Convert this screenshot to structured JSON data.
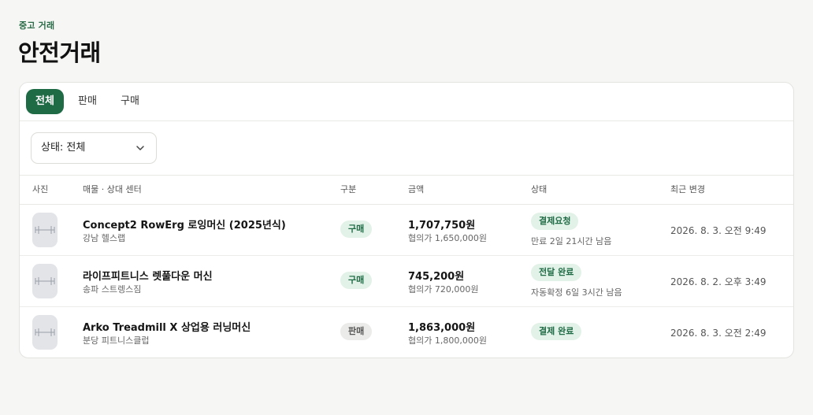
{
  "header": {
    "eyebrow": "중고 거래",
    "title": "안전거래"
  },
  "tabs": [
    {
      "label": "전체",
      "active": true
    },
    {
      "label": "판매",
      "active": false
    },
    {
      "label": "구매",
      "active": false
    }
  ],
  "filter": {
    "status_select": "상태: 전체"
  },
  "table": {
    "columns": [
      "사진",
      "매물 · 상대 센터",
      "구분",
      "금액",
      "상태",
      "최근 변경"
    ],
    "rows": [
      {
        "photo_icon": "barbell-icon",
        "name": "Concept2 RowErg 로잉머신 (2025년식)",
        "center": "강남 헬스랩",
        "type": "구매",
        "amount": "1,707,750원",
        "negotiated": "협의가 1,650,000원",
        "status": "결제요청",
        "status_note": "만료 2일 21시간 남음",
        "updated": "2026. 8. 3. 오전 9:49"
      },
      {
        "photo_icon": "barbell-icon",
        "name": "라이프피트니스 렛풀다운 머신",
        "center": "송파 스트렝스짐",
        "type": "구매",
        "amount": "745,200원",
        "negotiated": "협의가 720,000원",
        "status": "전달 완료",
        "status_note": "자동확정 6일 3시간 남음",
        "updated": "2026. 8. 2. 오후 3:49"
      },
      {
        "photo_icon": "barbell-icon",
        "name": "Arko Treadmill X 상업용 러닝머신",
        "center": "분당 피트니스클럽",
        "type": "판매",
        "amount": "1,863,000원",
        "negotiated": "협의가 1,800,000원",
        "status": "결제 완료",
        "status_note": "",
        "updated": "2026. 8. 3. 오전 2:49"
      }
    ]
  },
  "colors": {
    "accent": "#1f6b45",
    "badge_green_bg": "#e2f2e8",
    "badge_gray_bg": "#ebebe9",
    "background": "#f6f6f4"
  }
}
